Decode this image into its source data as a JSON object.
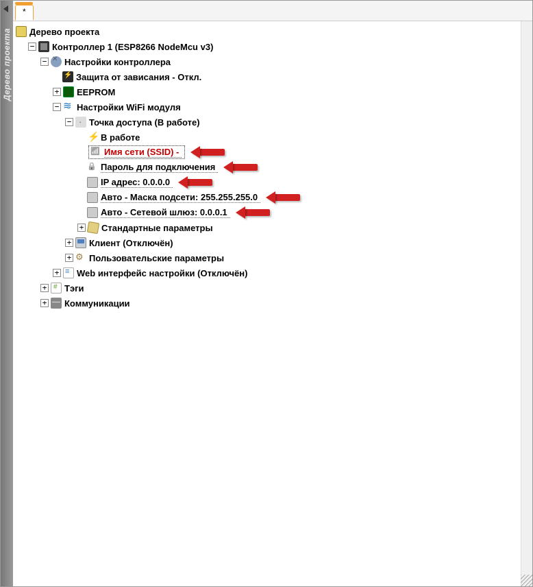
{
  "sidebar": {
    "title": "Дерево проекта"
  },
  "tab": {
    "label": "*"
  },
  "tree": {
    "root": {
      "label": "Дерево проекта"
    },
    "controller": {
      "label": "Контроллер 1 (ESP8266 NodeMcu v3)"
    },
    "ctrl_settings": {
      "label": "Настройки контроллера"
    },
    "watchdog": {
      "label": "Защита от зависания - Откл."
    },
    "eeprom": {
      "label": "EEPROM"
    },
    "wifi": {
      "label": "Настройки WiFi модуля"
    },
    "ap": {
      "label": "Точка доступа (В работе)"
    },
    "running": {
      "label": "В работе"
    },
    "ssid": {
      "label": "Имя сети (SSID) -"
    },
    "password": {
      "label": "Пароль для подключения"
    },
    "ip": {
      "label": "IP адрес: 0.0.0.0"
    },
    "mask": {
      "label": "Авто - Маска подсети: 255.255.255.0"
    },
    "gateway": {
      "label": "Авто - Сетевой шлюз: 0.0.0.1"
    },
    "std_params": {
      "label": "Стандартные параметры"
    },
    "client": {
      "label": "Клиент (Отключён)"
    },
    "user_params": {
      "label": "Пользовательские параметры"
    },
    "web": {
      "label": "Web интерфейс настройки (Отключён)"
    },
    "tags": {
      "label": "Тэги"
    },
    "comm": {
      "label": "Коммуникации"
    }
  },
  "expanders": {
    "minus": "−",
    "plus": "+"
  }
}
